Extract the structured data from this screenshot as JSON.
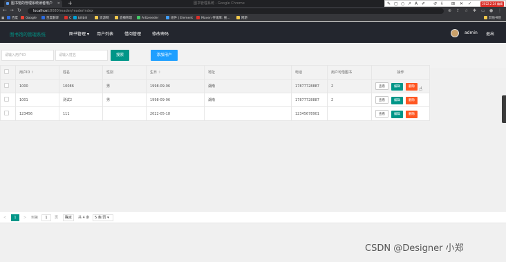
{
  "browser": {
    "tab_title": "图书馆的管理系统读者用户",
    "tab_close": "×",
    "new_tab": "+",
    "window_title": "图书管理系统 - Google Chrome",
    "url_host": "localhost",
    "url_path": ":8080/reader/readerIndex",
    "annot_time": "2022.2.24 编辑",
    "bookmarks": [
      {
        "label": "百度",
        "color": "#2d6cdf"
      },
      {
        "label": "Google",
        "color": "#ea4335"
      },
      {
        "label": "百度翻译",
        "color": "#2d6cdf"
      },
      {
        "label": "C",
        "color": "#d9302a"
      },
      {
        "label": "bilibili",
        "color": "#00a1d6"
      },
      {
        "label": "资源网",
        "color": "#f2c94c"
      },
      {
        "label": "直播管理",
        "color": "#f2c94c"
      },
      {
        "label": "Artbreeder",
        "color": "#44c767"
      },
      {
        "label": "组件 | Element",
        "color": "#409eff"
      },
      {
        "label": "Maven 存储库: 搜...",
        "color": "#d9302a"
      },
      {
        "label": "网游",
        "color": "#f2c94c"
      },
      {
        "label": "其他书签",
        "color": "#f2c94c"
      }
    ]
  },
  "header": {
    "logo": "图书馆的管理系统",
    "menu": [
      "图书管理 ▾",
      "用户列表",
      "借阅管理",
      "修改密码"
    ],
    "user": "admin",
    "logout": "退出"
  },
  "toolbar": {
    "id_placeholder": "请输入用户ID",
    "name_placeholder": "请输入姓名",
    "search_label": "搜索",
    "add_label": "添加用户"
  },
  "table": {
    "headers": [
      "用户ID",
      "姓名",
      "性别",
      "生日",
      "地址",
      "电话",
      "用户可借图书",
      "操作"
    ],
    "rows": [
      {
        "id": "1000",
        "name": "10086",
        "gender": "男",
        "birthday": "1998-09-06",
        "address": "湖南",
        "phone": "17877728887",
        "quota": "2"
      },
      {
        "id": "1001",
        "name": "测试2",
        "gender": "男",
        "birthday": "1998-09-06",
        "address": "湖南",
        "phone": "17877728887",
        "quota": "2"
      },
      {
        "id": "123456",
        "name": "111",
        "gender": "",
        "birthday": "2022-05-18",
        "address": "",
        "phone": "12345678901",
        "quota": ""
      }
    ],
    "actions": {
      "view": "查看",
      "edit": "编辑",
      "delete": "删除"
    }
  },
  "pager": {
    "prev": "<",
    "current": "1",
    "next": ">",
    "goto_label": "到第",
    "goto_value": "1",
    "page_unit": "页",
    "confirm": "确定",
    "total": "共 4 条",
    "page_size": "5 条/页"
  },
  "watermark": "CSDN @Designer 小郑",
  "colors": {
    "primary": "#009688",
    "blue": "#1e9fff",
    "danger": "#ff5722",
    "header": "#23262e"
  }
}
